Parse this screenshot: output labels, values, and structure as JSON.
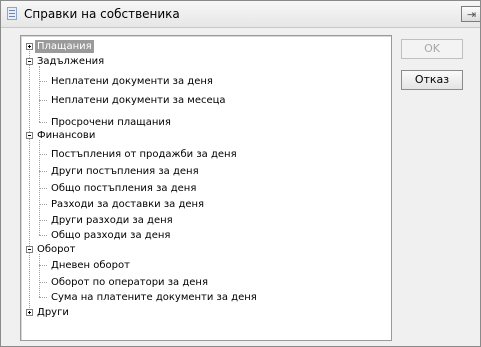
{
  "window": {
    "title": "Справки на собственика"
  },
  "buttons": {
    "ok": "OK",
    "cancel": "Отказ"
  },
  "tree": {
    "plashtania": "Плащания",
    "zadalzhenia": "Задължения",
    "zadalzhenia_items": [
      "Неплатени документи за деня",
      "Неплатени документи за месеца",
      "Просрочени плащания"
    ],
    "finansovi": "Финансови",
    "finansovi_items": [
      "Постъпления от продажби за деня",
      "Други постъпления за деня",
      "Общо постъпления за деня",
      "Разходи за доставки за деня",
      "Други разходи за деня",
      "Общо разходи за деня"
    ],
    "oborot": "Оборот",
    "oborot_items": [
      "Дневен оборот",
      "Оборот по оператори за деня",
      "Сума на платените документи за деня"
    ],
    "drugi": "Други"
  }
}
